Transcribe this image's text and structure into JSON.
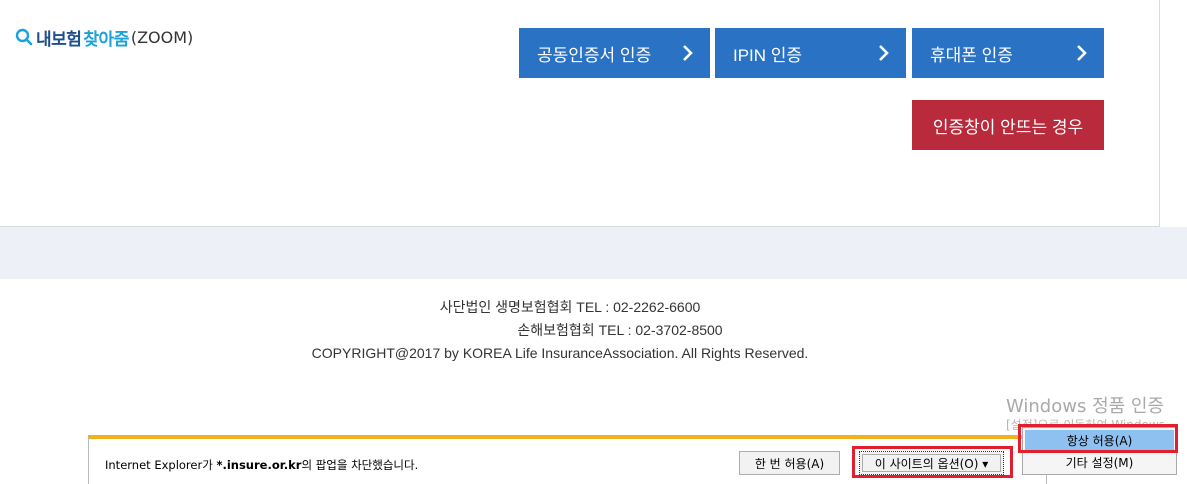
{
  "header": {
    "logo_part1": "내보험",
    "logo_part2": "찾아줌",
    "logo_part3": "(ZOOM)"
  },
  "auth_buttons": [
    {
      "label": "공동인증서 인증"
    },
    {
      "label": "IPIN 인증"
    },
    {
      "label": "휴대폰 인증"
    }
  ],
  "help_button": {
    "label": "인증창이 안뜨는 경우"
  },
  "footer": {
    "line1": "사단법인 생명보험협회 TEL : 02-2262-6600",
    "line2": "손해보험협회 TEL : 02-3702-8500",
    "line3": "COPYRIGHT@2017 by KOREA Life InsuranceAssociation. All Rights Reserved."
  },
  "watermark": {
    "line1": "Windows 정품 인증",
    "line2": "[설정]으로 이동하여 Windows"
  },
  "notification": {
    "prefix": "Internet Explorer가 ",
    "domain": "*.insure.or.kr",
    "suffix": "의 팝업을 차단했습니다.",
    "allow_once": "한 번 허용(A)",
    "site_options": "이 사이트의 옵션(O) ▾"
  },
  "options_menu": {
    "always_allow": "항상 허용(A)",
    "more_settings": "기타 설정(M)"
  },
  "colors": {
    "auth_blue": "#2a72c4",
    "help_red": "#b92a3c",
    "notif_bar": "#f2b11a",
    "highlight_red": "#e2202d"
  }
}
